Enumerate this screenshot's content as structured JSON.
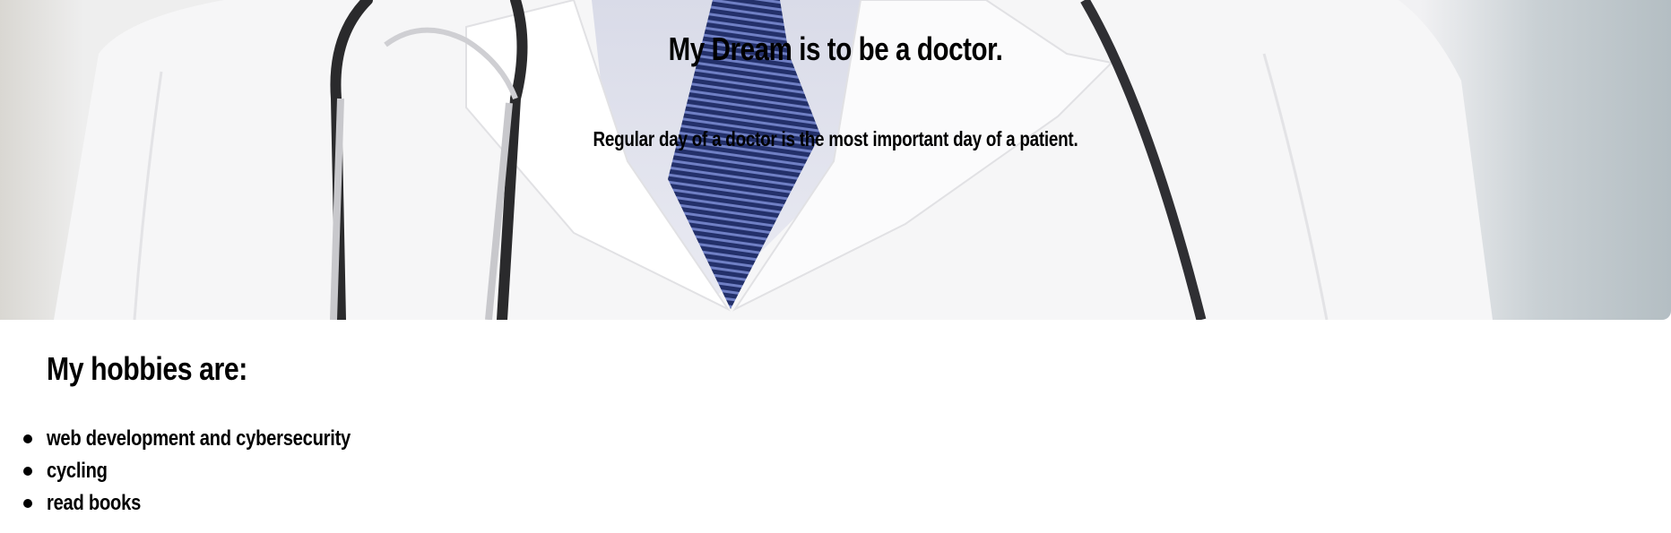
{
  "hero": {
    "title": "My Dream is to be a doctor.",
    "subtitle": "Regular day of a doctor is the most important day of a patient.",
    "image_subject": "doctor in white coat with stethoscope and blue striped tie"
  },
  "hobbies": {
    "title": "My hobbies are:",
    "items": [
      "web development and cybersecurity",
      "cycling",
      "read books"
    ]
  },
  "colors": {
    "text": "#000000",
    "background": "#ffffff",
    "coat": "#f4f4f6",
    "tie": "#2b3a7a"
  }
}
